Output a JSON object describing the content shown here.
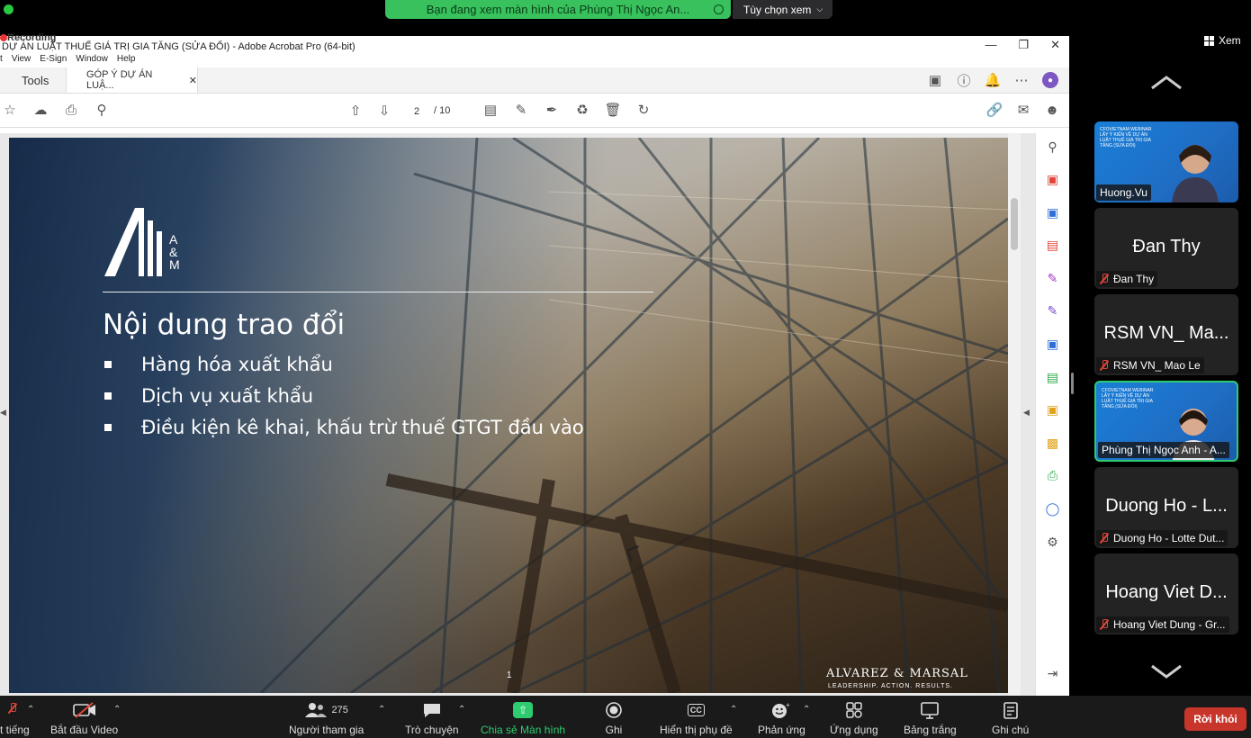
{
  "zoom_banner": {
    "viewing_text": "Bạn đang xem màn hình của Phùng Thị Ngọc An...",
    "view_options": "Tùy chọn xem",
    "view_label": "Xem"
  },
  "acrobat": {
    "recording_label": "Recording",
    "window_title": "DỰ ÁN LUẬT THUẾ GIÁ TRỊ GIA TĂNG (SỬA ĐỔI) - Adobe Acrobat Pro (64-bit)",
    "menu": [
      "t",
      "View",
      "E-Sign",
      "Window",
      "Help"
    ],
    "tabs": {
      "tools": "Tools",
      "document": "GÓP Ý DỰ ÁN LUẬ..."
    },
    "page_current": "2",
    "page_total": "/ 10"
  },
  "slide": {
    "logo_letters": [
      "A",
      "&",
      "M"
    ],
    "title": "Nội dung trao đổi",
    "bullets": [
      "Hàng hóa xuất khẩu",
      "Dịch vụ xuất khẩu",
      "Điều kiện kê khai, khấu trừ thuế GTGT đầu vào"
    ],
    "brand": "ALVAREZ & MARSAL",
    "tagline": "LEADERSHIP. ACTION. RESULTS.",
    "slide_number": "1"
  },
  "gallery": {
    "tiles": [
      {
        "name": "Huong.Vu",
        "big": "",
        "video": true,
        "muted": false,
        "active": false
      },
      {
        "name": "Đan Thy",
        "big": "Đan Thy",
        "video": false,
        "muted": true,
        "active": false
      },
      {
        "name": "RSM VN_ Mao Le",
        "big": "RSM VN_ Ma...",
        "video": false,
        "muted": true,
        "active": false
      },
      {
        "name": "Phùng Thị Ngọc Anh - A...",
        "big": "",
        "video": true,
        "muted": false,
        "active": true
      },
      {
        "name": "Duong Ho - Lotte Dut...",
        "big": "Duong Ho - L...",
        "video": false,
        "muted": true,
        "active": false
      },
      {
        "name": "Hoang Viet Dung - Gr...",
        "big": "Hoang Viet D...",
        "video": false,
        "muted": true,
        "active": false
      }
    ],
    "webinar_text": "CFOVIETNAM WEBINAR LẤY Ý KIẾN VỀ DỰ ÁN LUẬT THUẾ GIÁ TRỊ GIA TĂNG (SỬA ĐỔI)"
  },
  "toolbar": {
    "mute": "t tiếng",
    "video": "Bắt đầu Video",
    "participants": "Người tham gia",
    "participants_count": "275",
    "chat": "Trò chuyện",
    "share": "Chia sẻ Màn hình",
    "record": "Ghi",
    "captions": "Hiển thị phụ đề",
    "cc": "CC",
    "reactions": "Phản ứng",
    "apps": "Ứng dụng",
    "whiteboard": "Bảng trắng",
    "notes": "Ghi chú",
    "leave": "Rời khỏi"
  }
}
